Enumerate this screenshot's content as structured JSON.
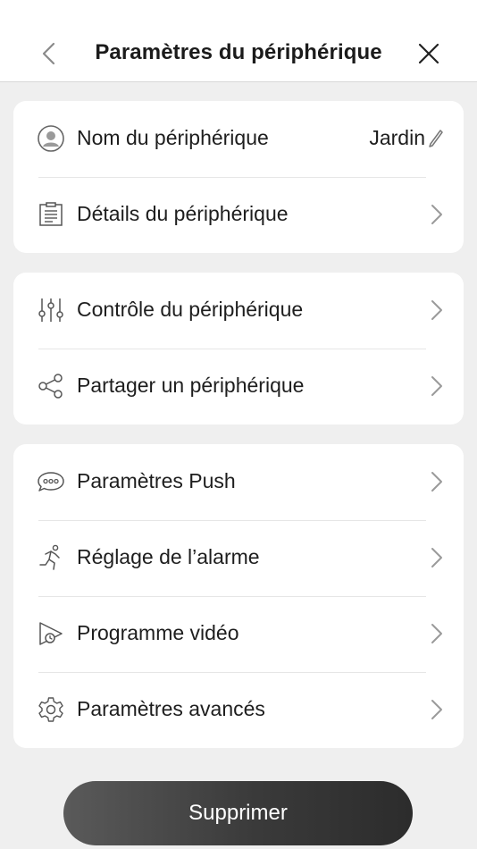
{
  "header": {
    "title": "Paramètres du périphérique",
    "back_icon": "chevron-left-icon",
    "close_icon": "close-icon"
  },
  "group1": {
    "device_name": {
      "label": "Nom du périphérique",
      "value": "Jardin",
      "icon": "user-circle-icon",
      "edit_icon": "pencil-icon"
    },
    "device_details": {
      "label": "Détails du périphérique",
      "icon": "document-list-icon"
    }
  },
  "group2": {
    "device_control": {
      "label": "Contrôle du périphérique",
      "icon": "sliders-icon"
    },
    "share_device": {
      "label": "Partager un périphérique",
      "icon": "share-icon"
    }
  },
  "group3": {
    "push_settings": {
      "label": "Paramètres Push",
      "icon": "chat-bubble-icon"
    },
    "alarm_settings": {
      "label": "Réglage de l’alarme",
      "icon": "running-person-icon"
    },
    "video_schedule": {
      "label": "Programme vidéo",
      "icon": "video-schedule-icon"
    },
    "advanced_settings": {
      "label": "Paramètres avancés",
      "icon": "gear-icon"
    }
  },
  "delete_button": {
    "label": "Supprimer"
  },
  "colors": {
    "background": "#efefef",
    "card": "#ffffff",
    "icon_stroke": "#555555",
    "chevron": "#9a9a9a",
    "button_dark": "#2c2c2c"
  }
}
